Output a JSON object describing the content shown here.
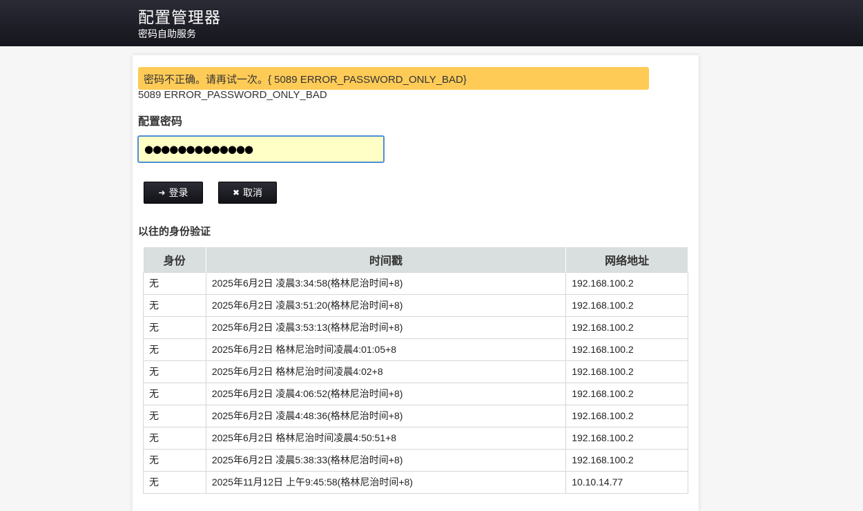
{
  "header": {
    "title": "配置管理器",
    "subtitle": "密码自助服务",
    "bg_color": "#1c1c24"
  },
  "alert": {
    "message": "密码不正确。请再试一次。{ 5089 ERROR_PASSWORD_ONLY_BAD}",
    "color": "#ffcb57"
  },
  "error_code": "5089 ERROR_PASSWORD_ONLY_BAD",
  "form": {
    "password_label": "配置密码",
    "password_value": "●●●●●●●●●●●●●",
    "login_label": "登录",
    "login_icon": "sign-in-icon",
    "cancel_label": "取消",
    "cancel_icon": "close-icon"
  },
  "history": {
    "title": "以往的身份验证",
    "columns": [
      "身份",
      "时间戳",
      "网络地址"
    ],
    "rows": [
      [
        "无",
        "2025年6月2日 凌晨3:34:58(格林尼治时间+8)",
        "192.168.100.2"
      ],
      [
        "无",
        "2025年6月2日 凌晨3:51:20(格林尼治时间+8)",
        "192.168.100.2"
      ],
      [
        "无",
        "2025年6月2日 凌晨3:53:13(格林尼治时间+8)",
        "192.168.100.2"
      ],
      [
        "无",
        "2025年6月2日 格林尼治时间凌晨4:01:05+8",
        "192.168.100.2"
      ],
      [
        "无",
        "2025年6月2日 格林尼治时间凌晨4:02+8",
        "192.168.100.2"
      ],
      [
        "无",
        "2025年6月2日 凌晨4:06:52(格林尼治时间+8)",
        "192.168.100.2"
      ],
      [
        "无",
        "2025年6月2日 凌晨4:48:36(格林尼治时间+8)",
        "192.168.100.2"
      ],
      [
        "无",
        "2025年6月2日 格林尼治时间凌晨4:50:51+8",
        "192.168.100.2"
      ],
      [
        "无",
        "2025年6月2日 凌晨5:38:33(格林尼治时间+8)",
        "192.168.100.2"
      ],
      [
        "无",
        "2025年11月12日 上午9:45:58(格林尼治时间+8)",
        "10.10.14.77"
      ]
    ]
  }
}
